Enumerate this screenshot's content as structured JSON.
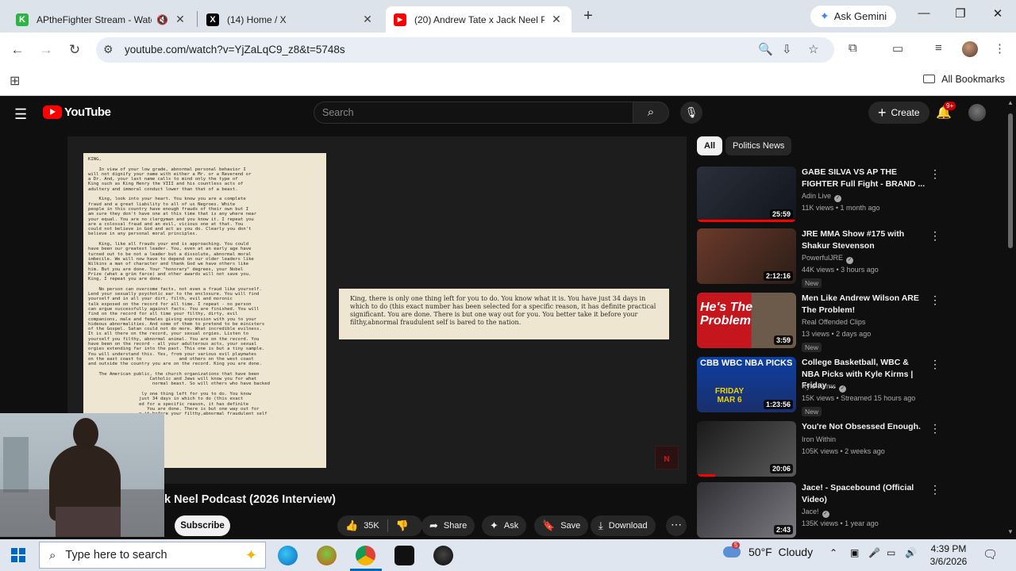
{
  "browser": {
    "tabs": [
      {
        "title": "APtheFighter Stream - Watc",
        "favicon_color": "#2fb344",
        "favicon_letter": "K",
        "muted": true
      },
      {
        "title": "(14) Home / X",
        "favicon_color": "#000000",
        "favicon_letter": "X",
        "muted": false
      },
      {
        "title": "(20) Andrew Tate x Jack Neel Po",
        "favicon_color": "#ff0000",
        "favicon_letter": "▶",
        "muted": false,
        "active": true
      }
    ],
    "new_tab": "+",
    "gemini_label": "Ask Gemini",
    "url": "youtube.com/watch?v=YjZaLqC9_z8&t=5748s",
    "bookmarks_all": "All Bookmarks"
  },
  "youtube": {
    "logo_text": "YouTube",
    "search_placeholder": "Search",
    "create_label": "Create",
    "notif_count": "9+",
    "video": {
      "title": "k Neel Podcast (2026 Interview)",
      "subscribe_label": "Subscribe",
      "likes": "35K",
      "share_label": "Share",
      "ask_label": "Ask",
      "save_label": "Save",
      "download_label": "Download"
    },
    "letter_lines": [
      "KING,",
      "",
      "    In view of your low grade, abnormal personal behavior I",
      "will not dignify your name with either a Mr. or a Reverend or",
      "a Dr. And, your last name calls to mind only the type of",
      "King such as King Henry the VIII and his countless acts of",
      "adultery and immoral conduct lower than that of a beast.",
      "",
      "    King, look into your heart. You know you are a complete",
      "fraud and a great liability to all of us Negroes. White",
      "people in this country have enough frauds of their own but I",
      "am sure they don't have one at this time that is any where near",
      "your equal. You are no clergyman and you know it. I repeat you",
      "are a colossal fraud and an evil, vicious one at that. You",
      "could not believe in God and act as you do. Clearly you don't",
      "believe in any personal moral principles.",
      "",
      "    King, like all frauds your end is approaching. You could",
      "have been our greatest leader. You, even at an early age have",
      "turned out to be not a leader but a dissolute, abnormal moral",
      "imbecile. We will now have to depend on our older leaders like",
      "Wilkins a man of character and thank God we have others like",
      "him. But you are done. Your \"honorary\" degrees, your Nobel",
      "Prize (what a grim farce) and other awards will not save you.",
      "King, I repeat you are done.",
      "",
      "    No person can overcome facts, not even a fraud like yourself.",
      "Lend your sexually psychotic ear to the enclosure. You will find",
      "yourself and in all your dirt, filth, evil and moronic",
      "talk exposed on the record for all time. I repeat - no person",
      "can argue successfully against facts. You are finished. You will",
      "find on the record for all time your filthy, dirty, evil",
      "companions, male and females giving expression with you to your",
      "hideous abnormalities. And some of them to pretend to be ministers",
      "of the Gospel. Satan could not do more. What incredible evilness.",
      "It is all there on the record, your sexual orgies. Listen to",
      "yourself you filthy, abnormal animal. You are on the record. You",
      "have been on the record - all your adulterous acts, your sexual",
      "orgies extending far into the past. This one is but a tiny sample.",
      "You will understand this. Yes, from your various evil playmates",
      "on the east coast to              and others on the west coast",
      "and outside the country you are on the record. King you are done.",
      "",
      "    The American public, the church organizations that have been",
      "                       Catholic and Jews will know you for what",
      "                        normal beast. So will others who have backed",
      "",
      "                    ly one thing left for you to do. You know",
      "                   just 34 days in which to do (this exact",
      "                   ed for a specific reason, it has definite",
      "                      You are done. There is but one way out for",
      "                   e it before your filthy,abnormal fraudulent self"
    ],
    "excerpt": "King, there is only one thing left for you to do. You know what it is. You have just 34 days in which to do (this exact number has been selected for a specific reason, it has definite practical significant. You are done. There is but one way out for you. You better take it before your filthy,abnormal fraudulent self is bared to the nation.",
    "watermark": "ɴ",
    "chips": [
      "All",
      "Politics News"
    ],
    "recommendations": [
      {
        "title": "GABE SILVA VS AP THE FIGHTER Full Fight - BRAND ...",
        "channel": "Adin Live",
        "verified": true,
        "meta": "11K views • 1 month ago",
        "duration": "25:59",
        "new": false,
        "progress": 1.0
      },
      {
        "title": "JRE MMA Show #175 with Shakur Stevenson",
        "channel": "PowerfulJRE",
        "verified": true,
        "meta": "44K views • 3 hours ago",
        "duration": "2:12:16",
        "new": true,
        "progress": 0
      },
      {
        "title": "Men Like Andrew Wilson ARE The Problem!",
        "channel": "Real Offended Clips",
        "verified": false,
        "meta": "13 views • 2 days ago",
        "duration": "3:59",
        "new": true,
        "progress": 0,
        "thumb_text": "He's The Problem"
      },
      {
        "title": "College Basketball, WBC & NBA Picks with Kyle Kirms | Friday ...",
        "channel": "Kyle Kirms",
        "verified": true,
        "meta": "15K views • Streamed 15 hours ago",
        "duration": "1:23:56",
        "new": true,
        "progress": 0,
        "thumb_text": "CBB WBC NBA PICKS",
        "thumb_text2": "FRIDAY MAR 6"
      },
      {
        "title": "You're Not Obsessed Enough.",
        "channel": "Iron Within",
        "verified": false,
        "meta": "105K views • 2 weeks ago",
        "duration": "20:06",
        "new": false,
        "progress": 0.18
      },
      {
        "title": "Jace! - Spacebound (Official Video)",
        "channel": "Jace!",
        "verified": true,
        "meta": "135K views • 1 year ago",
        "duration": "2:43",
        "new": false,
        "progress": 0
      }
    ]
  },
  "taskbar": {
    "search_placeholder": "Type here to search",
    "weather_temp": "50°F",
    "weather_desc": "Cloudy",
    "weather_badge": "5",
    "time": "4:39 PM",
    "date": "3/6/2026"
  }
}
